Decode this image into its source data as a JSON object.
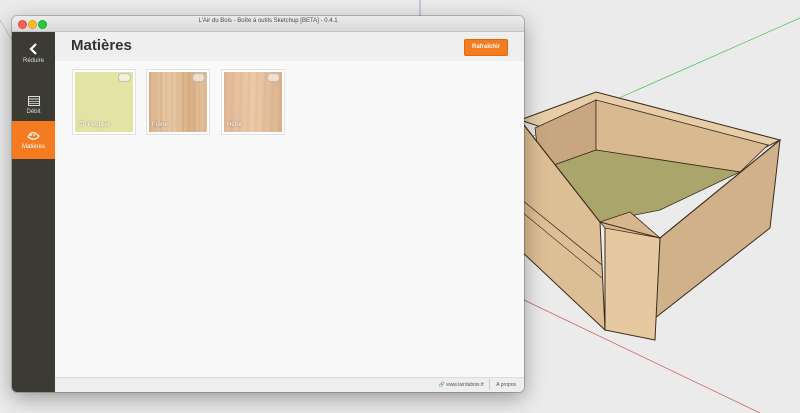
{
  "window": {
    "title": "L'Air du Bois - Boîte à outils Sketchup [BETA] - 0.4.1"
  },
  "sidebar": {
    "items": [
      {
        "label": "Réduire",
        "icon": "chevron-left-icon"
      },
      {
        "label": "Débit",
        "icon": "cut-list-icon"
      },
      {
        "label": "Matières",
        "icon": "materials-icon",
        "active": true
      }
    ]
  },
  "header": {
    "title": "Matières",
    "refresh_label": "Rafraîchir"
  },
  "materials": [
    {
      "name": "CP Peuplier",
      "color": "#e3e3a4"
    },
    {
      "name": "Frêne",
      "color": "#dfbc95"
    },
    {
      "name": "Hêtre",
      "color": "#e8c4a2"
    }
  ],
  "footer": {
    "site_link": "www.lairdubois.fr",
    "about_label": "A propos"
  },
  "colors": {
    "accent": "#f47b20",
    "sidebar": "#3b3a33"
  }
}
